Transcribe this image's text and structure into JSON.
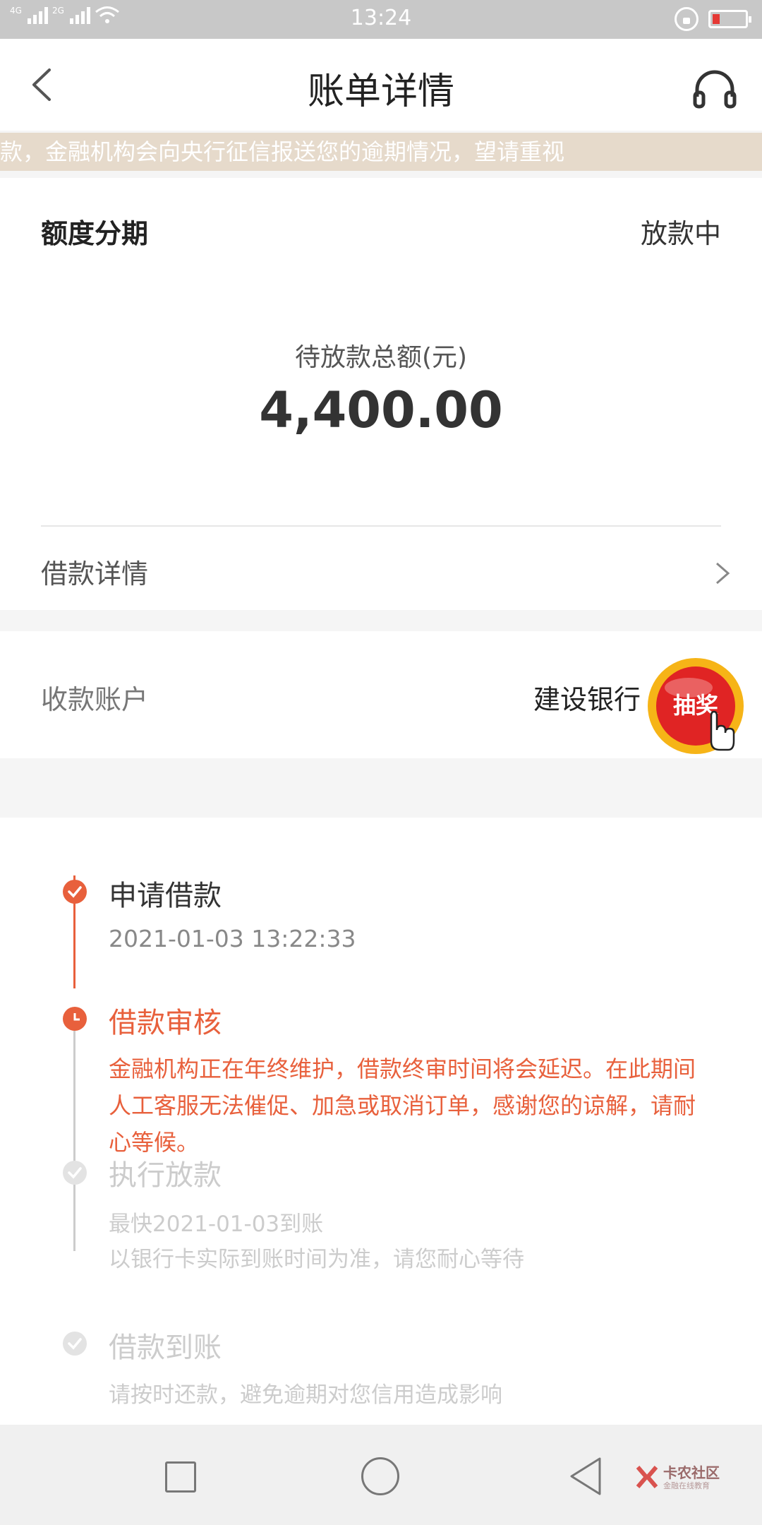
{
  "status_bar": {
    "network1": "4G",
    "network2": "2G",
    "time": "13:24"
  },
  "header": {
    "title": "账单详情"
  },
  "notice": {
    "text": "款，金融机构会向央行征信报送您的逾期情况，望请重视"
  },
  "loan": {
    "product": "额度分期",
    "status": "放款中",
    "amount_label": "待放款总额(元)",
    "amount": "4,400.00",
    "detail_label": "借款详情"
  },
  "account": {
    "label": "收款账户",
    "bank": "建设银行",
    "lottery_text": "抽奖"
  },
  "timeline": [
    {
      "title": "申请借款",
      "sub": "2021-01-03 13:22:33",
      "state": "done"
    },
    {
      "title": "借款审核",
      "desc": "金融机构正在年终维护，借款终审时间将会延迟。在此期间人工客服无法催促、加急或取消订单，感谢您的谅解，请耐心等候。",
      "state": "current"
    },
    {
      "title": "执行放款",
      "sub": "最快2021-01-03到账",
      "sub2": "以银行卡实际到账时间为准，请您耐心等待",
      "state": "pending"
    },
    {
      "title": "借款到账",
      "sub": "请按时还款，避免逾期对您信用造成影响",
      "state": "pending"
    }
  ],
  "watermark": {
    "name": "卡农社区",
    "tagline": "金融在线教育"
  },
  "colors": {
    "accent": "#e8603c",
    "pending": "#cccccc",
    "notice_bg": "#e6dacb"
  }
}
